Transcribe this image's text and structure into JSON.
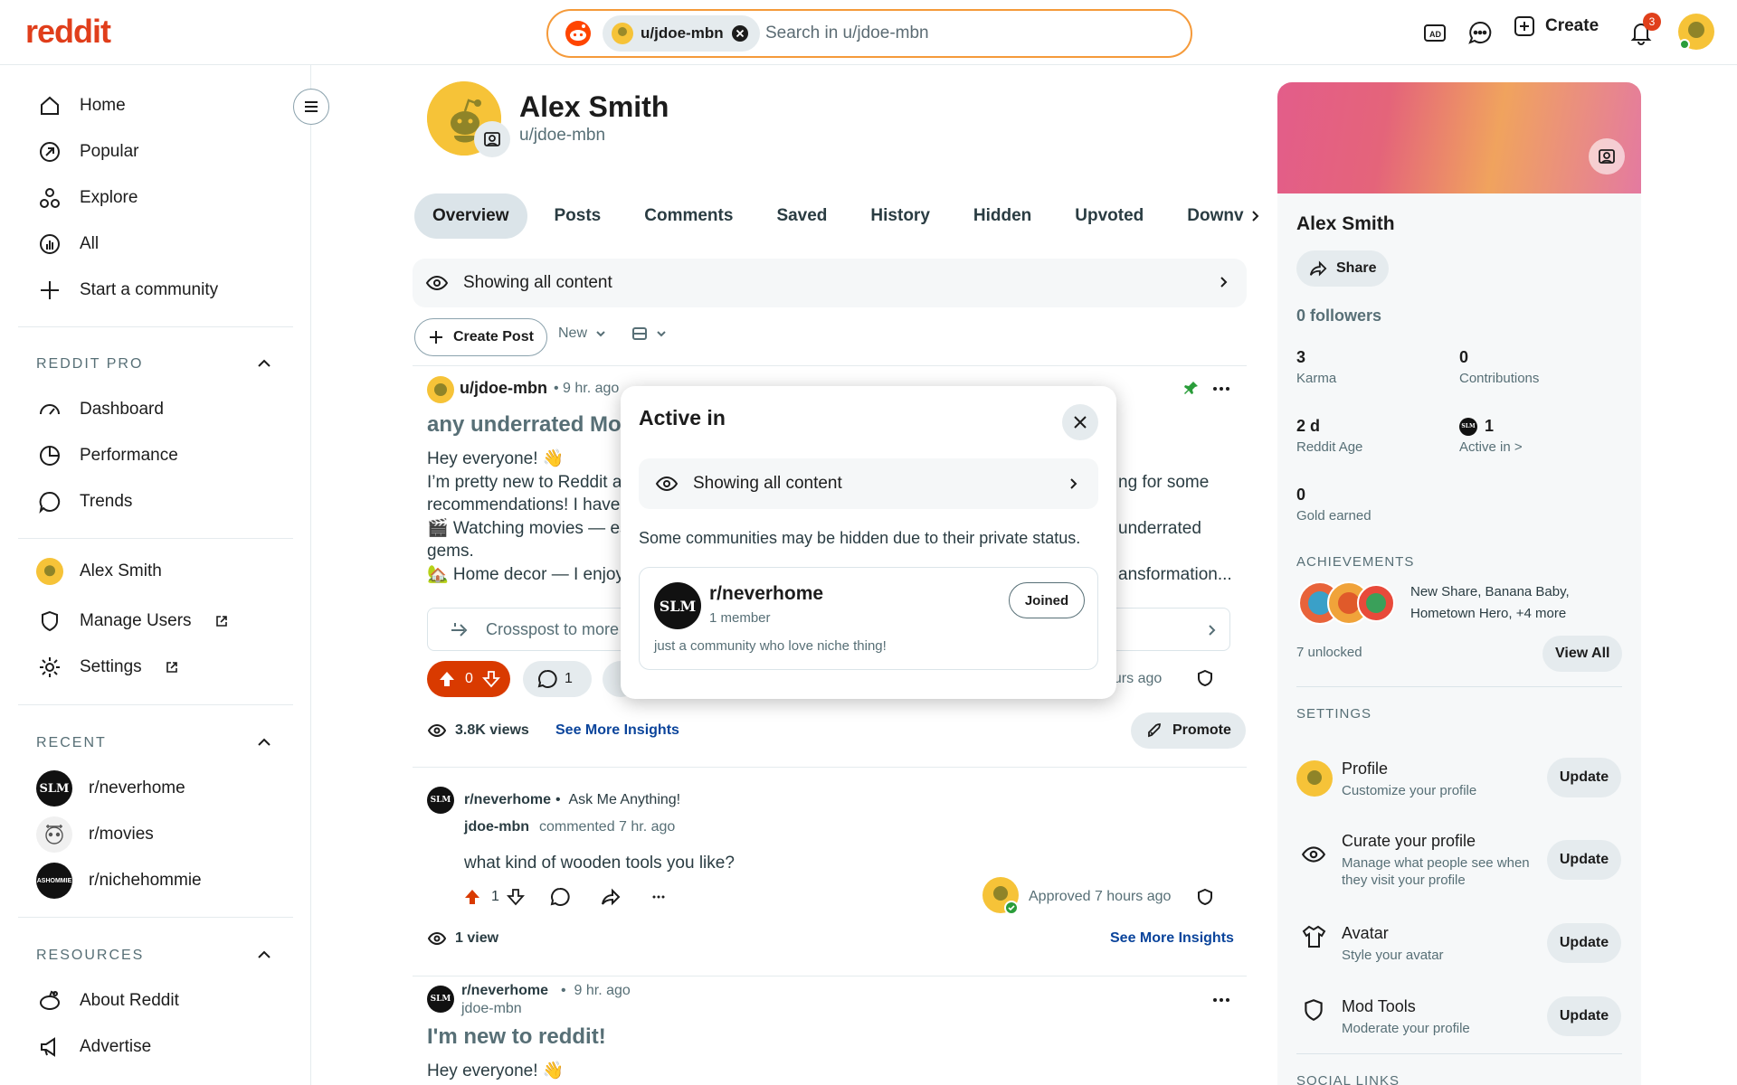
{
  "header": {
    "logo": "reddit",
    "search_chip": "u/jdoe-mbn",
    "search_placeholder": "Search in u/jdoe-mbn",
    "create_label": "Create",
    "notification_count": "3"
  },
  "sidebar": {
    "nav": [
      {
        "label": "Home",
        "icon": "home-icon"
      },
      {
        "label": "Popular",
        "icon": "popular-icon"
      },
      {
        "label": "Explore",
        "icon": "explore-icon"
      },
      {
        "label": "All",
        "icon": "all-icon"
      },
      {
        "label": "Start a community",
        "icon": "plus-icon"
      }
    ],
    "reddit_pro": {
      "title": "REDDIT PRO",
      "items": [
        {
          "label": "Dashboard",
          "icon": "dashboard-icon"
        },
        {
          "label": "Performance",
          "icon": "performance-icon"
        },
        {
          "label": "Trends",
          "icon": "trends-icon"
        }
      ]
    },
    "account": [
      {
        "label": "Alex Smith",
        "icon": "avatar"
      },
      {
        "label": "Manage Users",
        "icon": "shield-icon"
      },
      {
        "label": "Settings",
        "icon": "gear-icon"
      }
    ],
    "recent": {
      "title": "RECENT",
      "items": [
        {
          "label": "r/neverhome",
          "icon": "community-icon",
          "initials": "SLM"
        },
        {
          "label": "r/movies",
          "icon": "community-icon",
          "initials": ""
        },
        {
          "label": "r/nichehommie",
          "icon": "community-icon",
          "initials": "ASHOMMIE"
        }
      ]
    },
    "resources": {
      "title": "RESOURCES",
      "items": [
        {
          "label": "About Reddit",
          "icon": "reddit-icon"
        },
        {
          "label": "Advertise",
          "icon": "megaphone-icon"
        }
      ]
    }
  },
  "profile": {
    "name": "Alex Smith",
    "username": "u/jdoe-mbn",
    "tabs": [
      "Overview",
      "Posts",
      "Comments",
      "Saved",
      "History",
      "Hidden",
      "Upvoted",
      "Downv"
    ],
    "active_tab": "Overview",
    "showing": "Showing all content",
    "create_post": "Create Post",
    "sort": "New"
  },
  "feed": {
    "post1": {
      "author": "u/jdoe-mbn",
      "time": "9 hr. ago",
      "title": "any underrated Mov",
      "lines": [
        "Hey everyone! 👋",
        "I’m pretty new to Reddit a",
        "recommendations! I have t",
        "🎬 Watching movies — esp",
        "gems.",
        "🏡 Home decor — I enjoy c"
      ],
      "right_text": [
        "ng for some",
        "",
        "underrated",
        "",
        "ansformation..."
      ],
      "crosspost": "Crosspost to more",
      "votes": "0",
      "comments": "1",
      "approved_time": "ours ago",
      "views": "3.8K views",
      "insights": "See More Insights",
      "promote": "Promote"
    },
    "comment": {
      "community": "r/neverhome",
      "post_title": "Ask Me Anything!",
      "author": "jdoe-mbn",
      "action": "commented 7 hr. ago",
      "text": "what kind of wooden tools you like?",
      "votes": "1",
      "approved": "Approved 7 hours ago",
      "views": "1 view",
      "insights": "See More Insights"
    },
    "post2": {
      "community": "r/neverhome",
      "time": "9 hr. ago",
      "author": "jdoe-mbn",
      "title": "I'm new to reddit!",
      "line1": "Hey everyone! 👋"
    }
  },
  "right": {
    "name": "Alex Smith",
    "share": "Share",
    "followers": "0 followers",
    "stats": [
      {
        "value": "3",
        "label": "Karma"
      },
      {
        "value": "0",
        "label": "Contributions"
      },
      {
        "value": "2 d",
        "label": "Reddit Age"
      },
      {
        "value": "1",
        "label": "Active in >"
      },
      {
        "value": "0",
        "label": "Gold earned"
      }
    ],
    "achievements_title": "ACHIEVEMENTS",
    "achievements_text": "New Share, Banana Baby, Hometown Hero, +4 more",
    "unlocked": "7 unlocked",
    "view_all": "View All",
    "settings_title": "SETTINGS",
    "settings": [
      {
        "title": "Profile",
        "sub": "Customize your profile",
        "button": "Update",
        "icon": "avatar"
      },
      {
        "title": "Curate your profile",
        "sub": "Manage what people see when they visit your profile",
        "button": "Update",
        "icon": "eye-icon"
      },
      {
        "title": "Avatar",
        "sub": "Style your avatar",
        "button": "Update",
        "icon": "shirt-icon"
      },
      {
        "title": "Mod Tools",
        "sub": "Moderate your profile",
        "button": "Update",
        "icon": "shield-icon"
      }
    ],
    "social_links": "SOCIAL LINKS"
  },
  "modal": {
    "title": "Active in",
    "showing": "Showing all content",
    "note": "Some communities may be hidden due to their private status.",
    "community": {
      "name": "r/neverhome",
      "members": "1 member",
      "description": "just a community who love niche thing!",
      "button": "Joined",
      "initials": "SLM"
    }
  },
  "colors": {
    "brand": "#e03e1b",
    "search_border": "#f59a3a",
    "upvote": "#d93a00",
    "link": "#0a449b",
    "online": "#2a9d3a"
  }
}
